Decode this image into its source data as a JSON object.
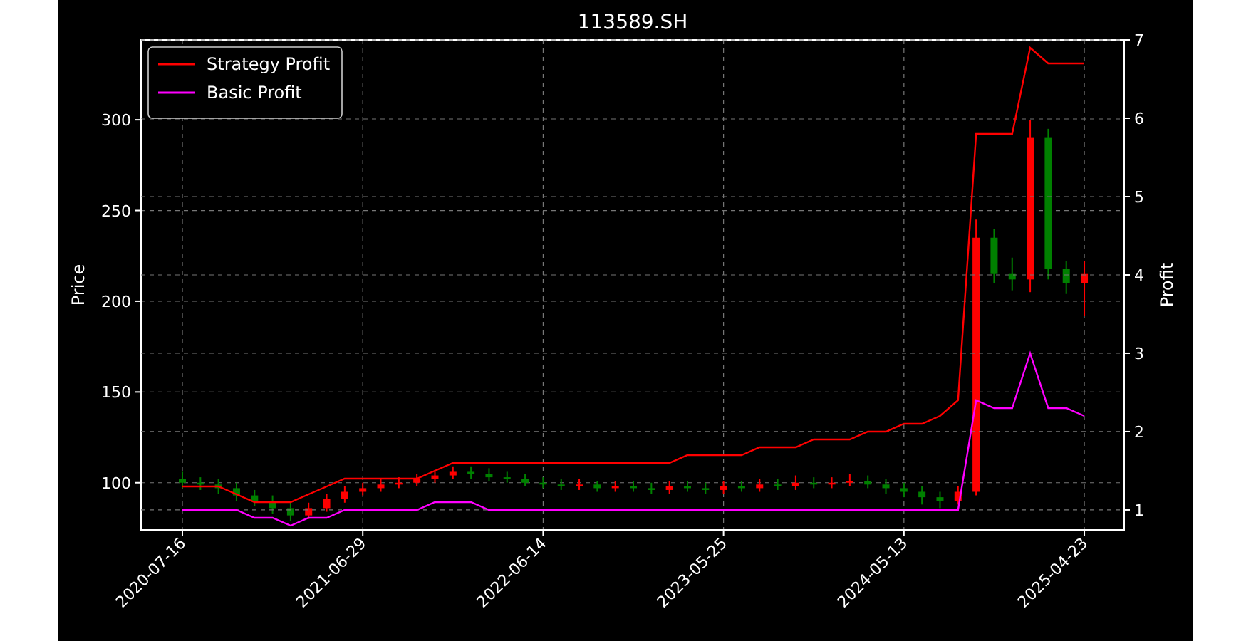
{
  "price_chart": {
    "chart_data": {
      "type": "candlestick",
      "title": "113589.SH",
      "ylabel": "Price",
      "categories": [
        "2020-07-16",
        null,
        null,
        null,
        null,
        null,
        null,
        null,
        null,
        null,
        "2021-06-29",
        null,
        null,
        null,
        null,
        null,
        null,
        null,
        null,
        null,
        "2022-06-14",
        null,
        null,
        null,
        null,
        null,
        null,
        null,
        null,
        null,
        "2023-05-25",
        null,
        null,
        null,
        null,
        null,
        null,
        null,
        null,
        null,
        "2024-05-13",
        null,
        null,
        null,
        null,
        null,
        null,
        null,
        null,
        null,
        "2025-04-23"
      ],
      "ohlc": [
        [
          102,
          106,
          97,
          100
        ],
        [
          100,
          103,
          96,
          99
        ],
        [
          99,
          102,
          94,
          97
        ],
        [
          97,
          100,
          90,
          93
        ],
        [
          93,
          96,
          87,
          90
        ],
        [
          90,
          93,
          83,
          86
        ],
        [
          86,
          89,
          79,
          82
        ],
        [
          82,
          89,
          80,
          86
        ],
        [
          86,
          94,
          84,
          91
        ],
        [
          91,
          98,
          89,
          95
        ],
        [
          95,
          100,
          93,
          97
        ],
        [
          97,
          102,
          95,
          99
        ],
        [
          99,
          103,
          97,
          100
        ],
        [
          100,
          105,
          98,
          102
        ],
        [
          102,
          107,
          100,
          104
        ],
        [
          104,
          109,
          102,
          106
        ],
        [
          106,
          109,
          102,
          105
        ],
        [
          105,
          108,
          101,
          103
        ],
        [
          103,
          106,
          100,
          102
        ],
        [
          102,
          105,
          98,
          100
        ],
        [
          100,
          103,
          97,
          99
        ],
        [
          99,
          102,
          96,
          98
        ],
        [
          98,
          102,
          96,
          99
        ],
        [
          99,
          101,
          95,
          97
        ],
        [
          97,
          101,
          95,
          98
        ],
        [
          98,
          101,
          95,
          97
        ],
        [
          97,
          100,
          94,
          96
        ],
        [
          96,
          101,
          94,
          98
        ],
        [
          98,
          101,
          95,
          97
        ],
        [
          97,
          100,
          94,
          96
        ],
        [
          96,
          101,
          94,
          98
        ],
        [
          98,
          101,
          95,
          97
        ],
        [
          97,
          102,
          95,
          99
        ],
        [
          99,
          102,
          96,
          98
        ],
        [
          98,
          104,
          96,
          100
        ],
        [
          100,
          103,
          97,
          99
        ],
        [
          99,
          103,
          97,
          100
        ],
        [
          100,
          105,
          98,
          101
        ],
        [
          101,
          104,
          97,
          99
        ],
        [
          99,
          102,
          94,
          97
        ],
        [
          97,
          100,
          92,
          95
        ],
        [
          95,
          98,
          88,
          92
        ],
        [
          92,
          95,
          86,
          90
        ],
        [
          90,
          98,
          88,
          95
        ],
        [
          95,
          245,
          93,
          235
        ],
        [
          235,
          240,
          210,
          215
        ],
        [
          215,
          224,
          206,
          212
        ],
        [
          212,
          300,
          205,
          290
        ],
        [
          290,
          295,
          212,
          218
        ],
        [
          218,
          222,
          204,
          210
        ],
        [
          210,
          222,
          192,
          215
        ]
      ],
      "ylim": [
        74,
        344
      ],
      "yticks": [
        100,
        150,
        200,
        250,
        300
      ],
      "grid": true
    }
  },
  "profit_chart": {
    "chart_data": {
      "type": "line",
      "ylabel": "Profit",
      "categories": [
        null,
        null,
        null,
        null,
        null,
        null,
        null,
        null,
        null,
        null,
        null,
        null,
        null,
        null,
        null,
        null,
        null,
        null,
        null,
        null,
        null,
        null,
        null,
        null,
        null,
        null,
        null,
        null,
        null,
        null,
        null,
        null,
        null,
        null,
        null,
        null,
        null,
        null,
        null,
        null,
        null,
        null,
        null,
        null,
        null,
        null,
        null,
        null,
        null,
        null,
        null
      ],
      "series": [
        {
          "name": "Strategy Profit",
          "color": "#ff0000",
          "values": [
            1.3,
            1.3,
            1.3,
            1.2,
            1.1,
            1.1,
            1.1,
            1.2,
            1.3,
            1.4,
            1.4,
            1.4,
            1.4,
            1.4,
            1.5,
            1.6,
            1.6,
            1.6,
            1.6,
            1.6,
            1.6,
            1.6,
            1.6,
            1.6,
            1.6,
            1.6,
            1.6,
            1.6,
            1.7,
            1.7,
            1.7,
            1.7,
            1.8,
            1.8,
            1.8,
            1.9,
            1.9,
            1.9,
            2.0,
            2.0,
            2.1,
            2.1,
            2.2,
            2.4,
            5.8,
            5.8,
            5.8,
            6.9,
            6.7,
            6.7,
            6.7
          ]
        },
        {
          "name": "Basic Profit",
          "color": "#ff00ff",
          "values": [
            1.0,
            1.0,
            1.0,
            1.0,
            0.9,
            0.9,
            0.8,
            0.9,
            0.9,
            1.0,
            1.0,
            1.0,
            1.0,
            1.0,
            1.1,
            1.1,
            1.1,
            1.0,
            1.0,
            1.0,
            1.0,
            1.0,
            1.0,
            1.0,
            1.0,
            1.0,
            1.0,
            1.0,
            1.0,
            1.0,
            1.0,
            1.0,
            1.0,
            1.0,
            1.0,
            1.0,
            1.0,
            1.0,
            1.0,
            1.0,
            1.0,
            1.0,
            1.0,
            1.0,
            2.4,
            2.3,
            2.3,
            3.0,
            2.3,
            2.3,
            2.2
          ]
        }
      ],
      "ylim": [
        0.745,
        7
      ],
      "yticks": [
        1,
        2,
        3,
        4,
        5,
        6,
        7
      ],
      "grid": true,
      "legend": "upper left"
    }
  }
}
